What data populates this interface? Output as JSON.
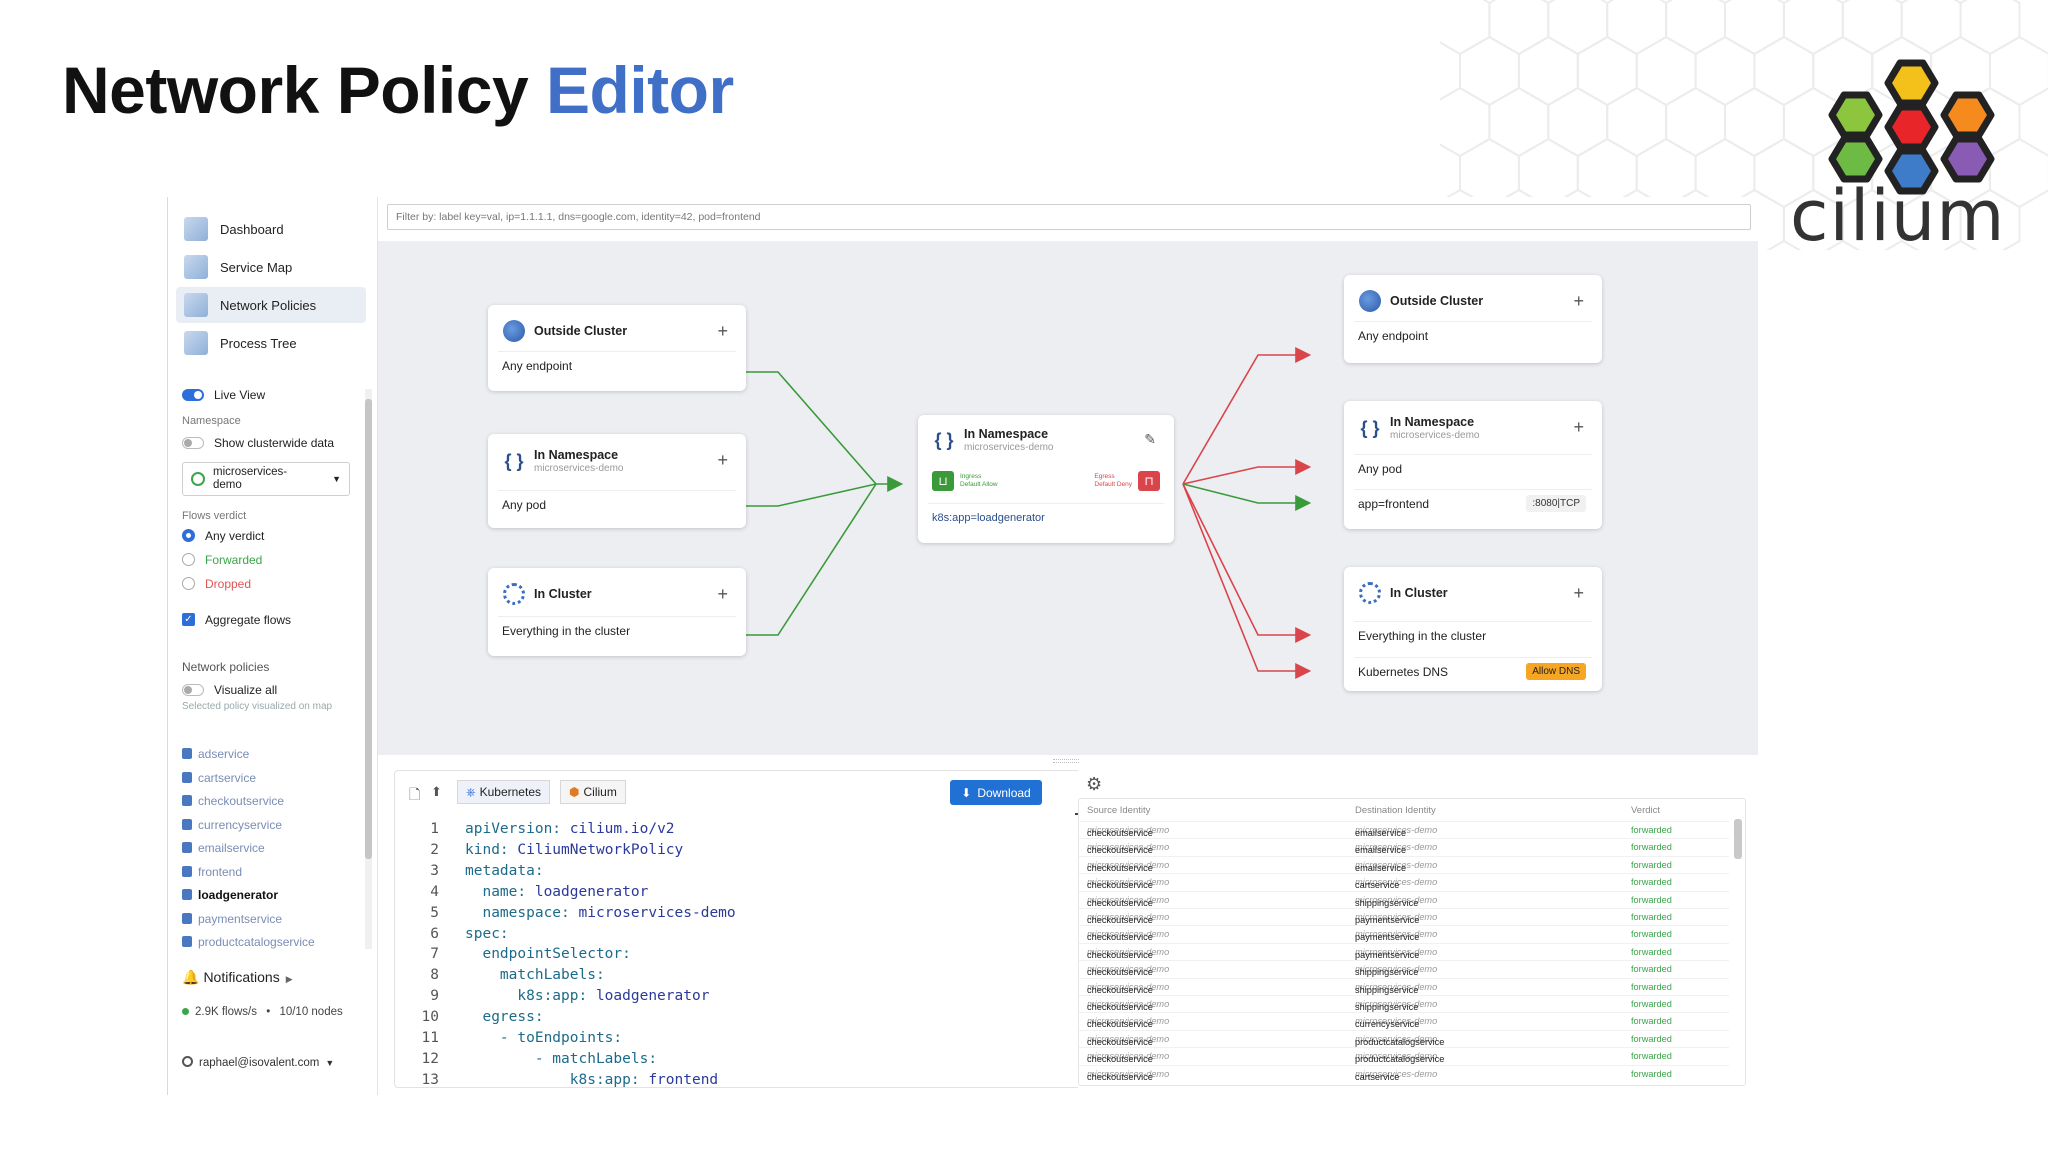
{
  "slide": {
    "title_part1": "Network Policy",
    "title_part2": "Editor",
    "logo_text": "cilium"
  },
  "sidebar": {
    "nav": [
      {
        "label": "Dashboard",
        "icon": "dashboard-icon"
      },
      {
        "label": "Service Map",
        "icon": "service-map-icon"
      },
      {
        "label": "Network Policies",
        "icon": "network-policies-icon",
        "active": true
      },
      {
        "label": "Process Tree",
        "icon": "process-tree-icon"
      }
    ],
    "live_view": "Live View",
    "namespace_label": "Namespace",
    "show_clusterwide": "Show clusterwide data",
    "namespace_value": "microservices-demo",
    "flows_verdict_label": "Flows verdict",
    "verdicts": [
      {
        "label": "Any verdict",
        "color": "#222222",
        "selected": true
      },
      {
        "label": "Forwarded",
        "color": "#3aa54a",
        "selected": false
      },
      {
        "label": "Dropped",
        "color": "#e05555",
        "selected": false
      }
    ],
    "aggregate_flows": "Aggregate flows",
    "network_policies_label": "Network policies",
    "visualize_all": "Visualize all",
    "selected_policy_hint": "Selected policy visualized on map",
    "policies": [
      "adservice",
      "cartservice",
      "checkoutservice",
      "currencyservice",
      "emailservice",
      "frontend",
      "loadgenerator",
      "paymentservice",
      "productcatalogservice"
    ],
    "selected_policy": "loadgenerator",
    "notifications": "Notifications",
    "stats_flows": "2.9K flows/s",
    "stats_nodes": "10/10 nodes",
    "user": "raphael@isovalent.com"
  },
  "filter": {
    "placeholder": "Filter by: label key=val, ip=1.1.1.1, dns=google.com, identity=42, pod=frontend"
  },
  "map": {
    "left": [
      {
        "title": "Outside Cluster",
        "sub": "",
        "row": "Any endpoint",
        "icon": "globe-icon"
      },
      {
        "title": "In Namespace",
        "sub": "microservices-demo",
        "row": "Any pod",
        "icon": "braces-icon"
      },
      {
        "title": "In Cluster",
        "sub": "",
        "row": "Everything in the cluster",
        "icon": "kubernetes-icon"
      }
    ],
    "center": {
      "title": "In Namespace",
      "sub": "microservices-demo",
      "ingress": "Ingress",
      "ingress_mode": "Default Allow",
      "egress": "Egress",
      "egress_mode": "Default Deny",
      "selector": "k8s:app=loadgenerator"
    },
    "right": [
      {
        "title": "Outside Cluster",
        "sub": "",
        "rows": [
          {
            "label": "Any endpoint"
          }
        ],
        "icon": "globe-icon"
      },
      {
        "title": "In Namespace",
        "sub": "microservices-demo",
        "rows": [
          {
            "label": "Any pod"
          },
          {
            "label": "app=frontend",
            "badge": ":8080|TCP"
          }
        ],
        "icon": "braces-icon"
      },
      {
        "title": "In Cluster",
        "sub": "",
        "rows": [
          {
            "label": "Everything in the cluster"
          },
          {
            "label": "Kubernetes DNS",
            "badge": "Allow DNS"
          }
        ],
        "icon": "kubernetes-icon"
      }
    ],
    "colors": {
      "allow": "#3a9a3a",
      "deny": "#d9454a"
    }
  },
  "editor": {
    "tab_kubernetes": "Kubernetes",
    "tab_cilium": "Cilium",
    "download": "Download",
    "lines": [
      [
        "1",
        "apiVersion: ",
        "cilium.io/v2"
      ],
      [
        "2",
        "kind: ",
        "CiliumNetworkPolicy"
      ],
      [
        "3",
        "metadata:",
        ""
      ],
      [
        "4",
        "  name: ",
        "loadgenerator"
      ],
      [
        "5",
        "  namespace: ",
        "microservices-demo"
      ],
      [
        "6",
        "spec:",
        ""
      ],
      [
        "7",
        "  endpointSelector:",
        ""
      ],
      [
        "8",
        "    matchLabels:",
        ""
      ],
      [
        "9",
        "      k8s:app: ",
        "loadgenerator"
      ],
      [
        "10",
        "  egress:",
        ""
      ],
      [
        "11",
        "    - toEndpoints:",
        ""
      ],
      [
        "12",
        "        - matchLabels:",
        ""
      ],
      [
        "13",
        "            k8s:app: ",
        "frontend"
      ]
    ]
  },
  "flows": {
    "headers": [
      "Source Identity",
      "Destination Identity",
      "Verdict"
    ],
    "rows": [
      [
        "checkoutservice",
        "microservices-demo",
        "emailservice",
        "microservices-demo",
        "forwarded"
      ],
      [
        "checkoutservice",
        "microservices-demo",
        "emailservice",
        "microservices-demo",
        "forwarded"
      ],
      [
        "checkoutservice",
        "microservices-demo",
        "emailservice",
        "microservices-demo",
        "forwarded"
      ],
      [
        "checkoutservice",
        "microservices-demo",
        "cartservice",
        "microservices-demo",
        "forwarded"
      ],
      [
        "checkoutservice",
        "microservices-demo",
        "shippingservice",
        "microservices-demo",
        "forwarded"
      ],
      [
        "checkoutservice",
        "microservices-demo",
        "paymentservice",
        "microservices-demo",
        "forwarded"
      ],
      [
        "checkoutservice",
        "microservices-demo",
        "paymentservice",
        "microservices-demo",
        "forwarded"
      ],
      [
        "checkoutservice",
        "microservices-demo",
        "paymentservice",
        "microservices-demo",
        "forwarded"
      ],
      [
        "checkoutservice",
        "microservices-demo",
        "shippingservice",
        "microservices-demo",
        "forwarded"
      ],
      [
        "checkoutservice",
        "microservices-demo",
        "shippingservice",
        "microservices-demo",
        "forwarded"
      ],
      [
        "checkoutservice",
        "microservices-demo",
        "shippingservice",
        "microservices-demo",
        "forwarded"
      ],
      [
        "checkoutservice",
        "microservices-demo",
        "currencyservice",
        "microservices-demo",
        "forwarded"
      ],
      [
        "checkoutservice",
        "microservices-demo",
        "productcatalogservice",
        "microservices-demo",
        "forwarded"
      ],
      [
        "checkoutservice",
        "microservices-demo",
        "productcatalogservice",
        "microservices-demo",
        "forwarded"
      ],
      [
        "checkoutservice",
        "microservices-demo",
        "cartservice",
        "microservices-demo",
        "forwarded"
      ]
    ]
  }
}
